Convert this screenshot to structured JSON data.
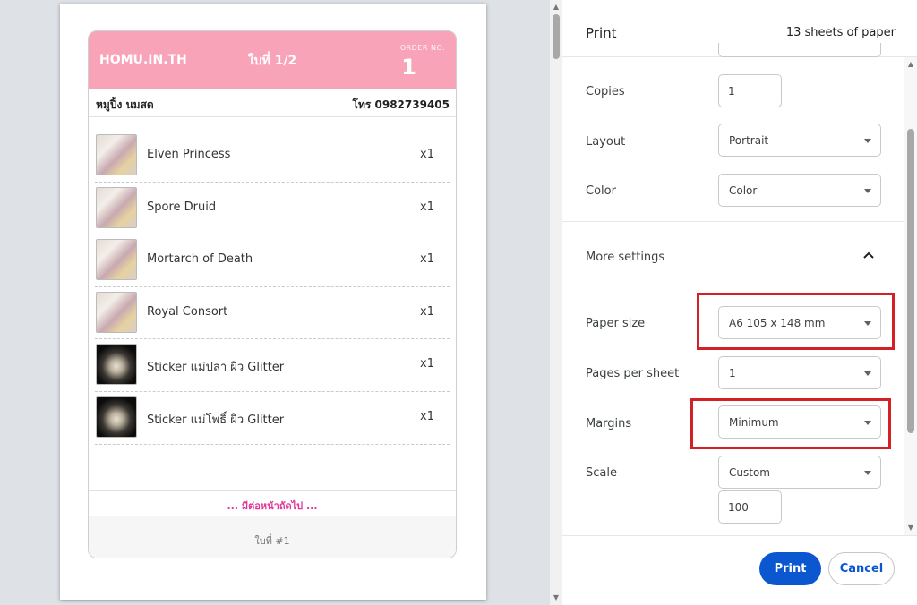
{
  "receipt": {
    "shop_name": "HOMU.IN.TH",
    "page_label": "ใบที่ 1/2",
    "order_label": "ORDER NO.",
    "order_number": "1",
    "customer_name": "หมูปิ้ง นมสด",
    "customer_phone": "โทร 0982739405",
    "header_color": "#f8a3b8",
    "items": [
      {
        "name": "Elven Princess",
        "qty": "x1"
      },
      {
        "name": "Spore Druid",
        "qty": "x1"
      },
      {
        "name": "Mortarch of Death",
        "qty": "x1"
      },
      {
        "name": "Royal Consort",
        "qty": "x1"
      },
      {
        "name": "Sticker แม่ปลา ผิว Glitter",
        "qty": "x1"
      },
      {
        "name": "Sticker แม่โพธิ์ ผิว Glitter",
        "qty": "x1"
      }
    ],
    "continued_text": "... มีต่อหน้าถัดไป ...",
    "footer_text": "ใบที่ #1"
  },
  "print_panel": {
    "title": "Print",
    "sheet_count": "13 sheets of paper",
    "copies_label": "Copies",
    "copies_value": "1",
    "layout_label": "Layout",
    "layout_value": "Portrait",
    "color_label": "Color",
    "color_value": "Color",
    "more_settings_label": "More settings",
    "paper_size_label": "Paper size",
    "paper_size_value": "A6 105 x 148 mm",
    "pages_per_sheet_label": "Pages per sheet",
    "pages_per_sheet_value": "1",
    "margins_label": "Margins",
    "margins_value": "Minimum",
    "scale_label": "Scale",
    "scale_value": "Custom",
    "scale_custom_value": "100",
    "print_button": "Print",
    "cancel_button": "Cancel",
    "accent_color": "#0b57d0",
    "highlight_color": "#d32024"
  }
}
